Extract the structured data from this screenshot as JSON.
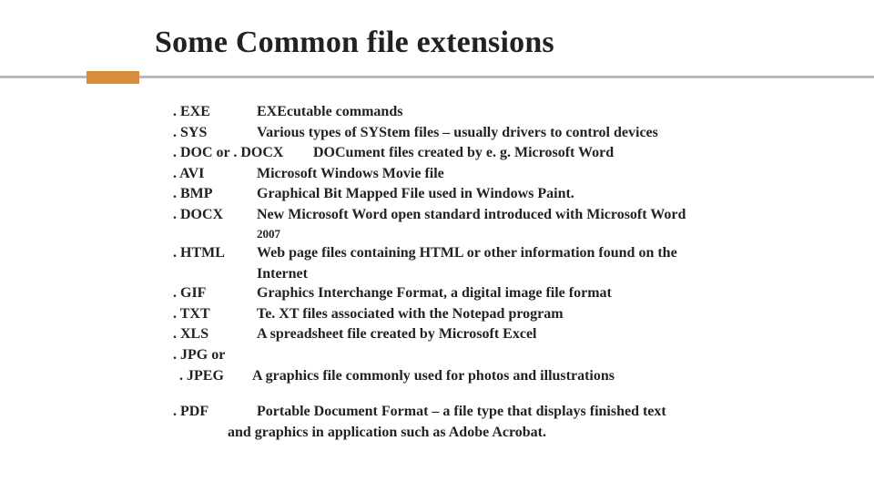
{
  "title": "Some Common file extensions",
  "items": {
    "exe": {
      "ext": ". EXE",
      "desc": "EXEcutable commands"
    },
    "sys": {
      "ext": ". SYS",
      "desc": "Various types of SYStem files – usually drivers to control devices"
    },
    "doc": {
      "ext": ". DOC or . DOCX",
      "desc": "DOCument files created by e. g. Microsoft Word"
    },
    "avi": {
      "ext": ". AVI",
      "desc": "Microsoft Windows Movie file"
    },
    "bmp": {
      "ext": ". BMP",
      "desc": "Graphical Bit Mapped File used in Windows Paint."
    },
    "docx": {
      "ext": ". DOCX",
      "desc": "New Microsoft Word open standard introduced with Microsoft Word",
      "sub": "2007"
    },
    "html": {
      "ext": ". HTML",
      "desc": "Web page files containing HTML or other information found on the",
      "cont": "Internet"
    },
    "gif": {
      "ext": ". GIF",
      "desc": "Graphics Interchange Format, a digital image file format"
    },
    "txt": {
      "ext": ". TXT",
      "desc": "Te. XT files associated with the Notepad program"
    },
    "xls": {
      "ext": ". XLS",
      "desc": "A spreadsheet file created by Microsoft Excel"
    },
    "jpg": {
      "ext1": ". JPG or",
      "ext2": " . JPEG",
      "desc": "A graphics file commonly used for photos and illustrations"
    },
    "pdf": {
      "ext": ". PDF",
      "desc": " Portable Document Format – a file type that displays finished text",
      "cont": "and graphics in application such as Adobe Acrobat."
    }
  }
}
